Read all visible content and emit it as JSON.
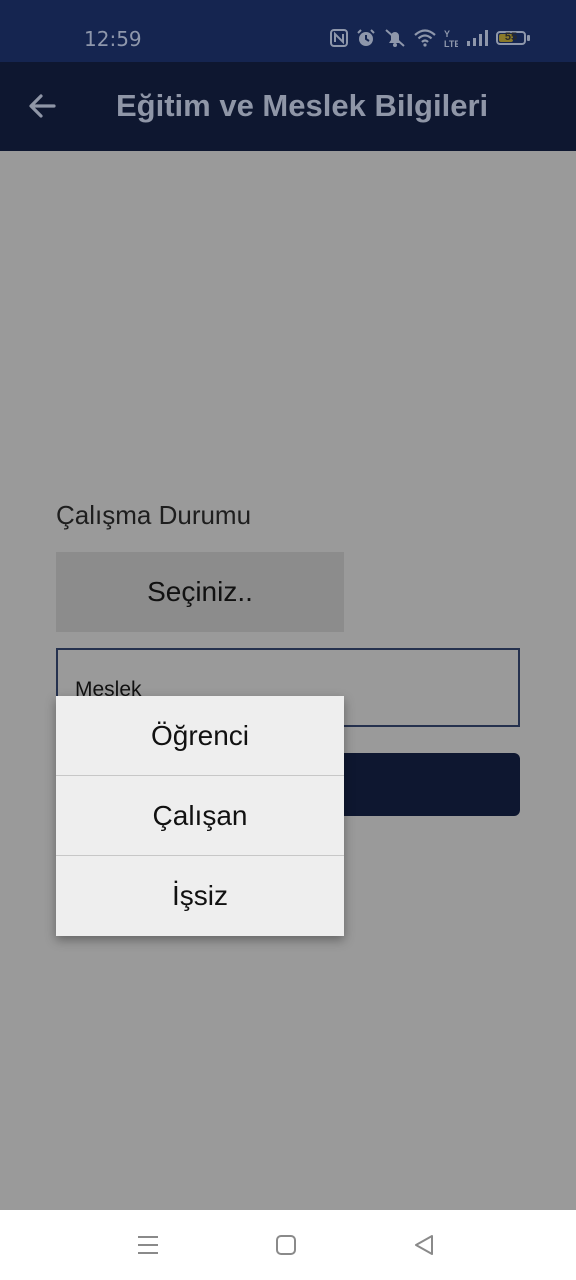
{
  "status_bar": {
    "time": "12:59",
    "battery_level": "55",
    "icons": [
      "nfc-icon",
      "alarm-icon",
      "mute-icon",
      "wifi-icon",
      "volte-icon",
      "signal-icon",
      "battery-icon"
    ]
  },
  "app_bar": {
    "back_icon": "arrow-left-icon",
    "title": "Eğitim ve Meslek Bilgileri"
  },
  "form": {
    "employment_label": "Çalışma Durumu",
    "employment_select_value": "Seçiniz..",
    "profession_placeholder": "Meslek"
  },
  "dropdown": {
    "options": [
      "Öğrenci",
      "Çalışan",
      "İşsiz"
    ]
  },
  "nav_bar": {
    "icons": [
      "menu-icon",
      "home-icon",
      "back-triangle-icon"
    ]
  },
  "colors": {
    "status_bar_bg": "#152550",
    "app_bar_bg": "#0e1730",
    "scrim_bg": "#9a9a9a",
    "dropdown_bg": "#eeeeee"
  }
}
